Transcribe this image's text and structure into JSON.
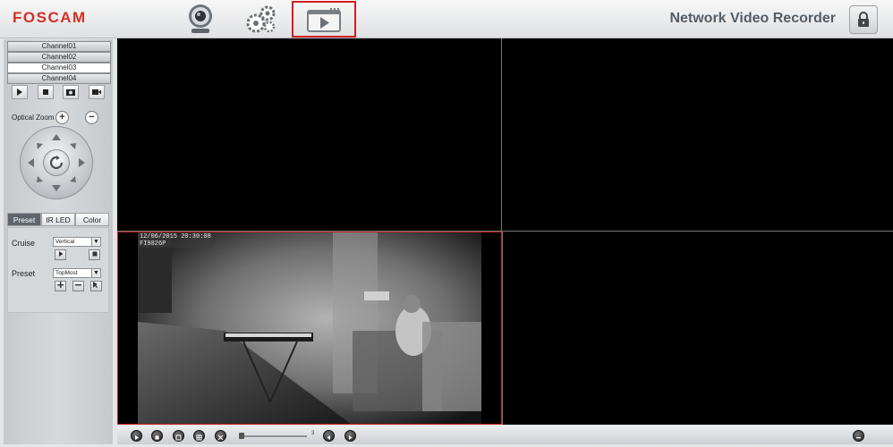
{
  "header": {
    "logo": "FOSCAM",
    "title": "Network Video Recorder",
    "nav": [
      {
        "name": "live-view",
        "icon": "camera-icon"
      },
      {
        "name": "settings",
        "icon": "gears-icon"
      },
      {
        "name": "playback",
        "icon": "play-icon",
        "selected": true
      }
    ],
    "lock_icon": "lock-icon",
    "accent": "#d52f23",
    "highlight": "#cf1f1f"
  },
  "sidebar": {
    "channels": [
      "Channel01",
      "Channel02",
      "Channel03",
      "Channel04"
    ],
    "active_channel": "Channel03",
    "controls": [
      "play-icon",
      "stop-icon",
      "snapshot-icon",
      "record-icon"
    ],
    "zoom_label": "Optical Zoom",
    "zoom_in": "+",
    "zoom_out": "−",
    "tabs": [
      "Preset",
      "IR LED",
      "Color"
    ],
    "active_tab": "Preset",
    "cruise_label": "Cruise",
    "cruise_value": "Vertical",
    "preset_label": "Preset",
    "preset_value": "TopMost"
  },
  "video": {
    "osd_datetime": "12/06/2015 20:30:08",
    "osd_id": "FI9826P",
    "active_cell_color": "#c81e1e"
  },
  "bottom": {
    "volume_value": "3"
  }
}
